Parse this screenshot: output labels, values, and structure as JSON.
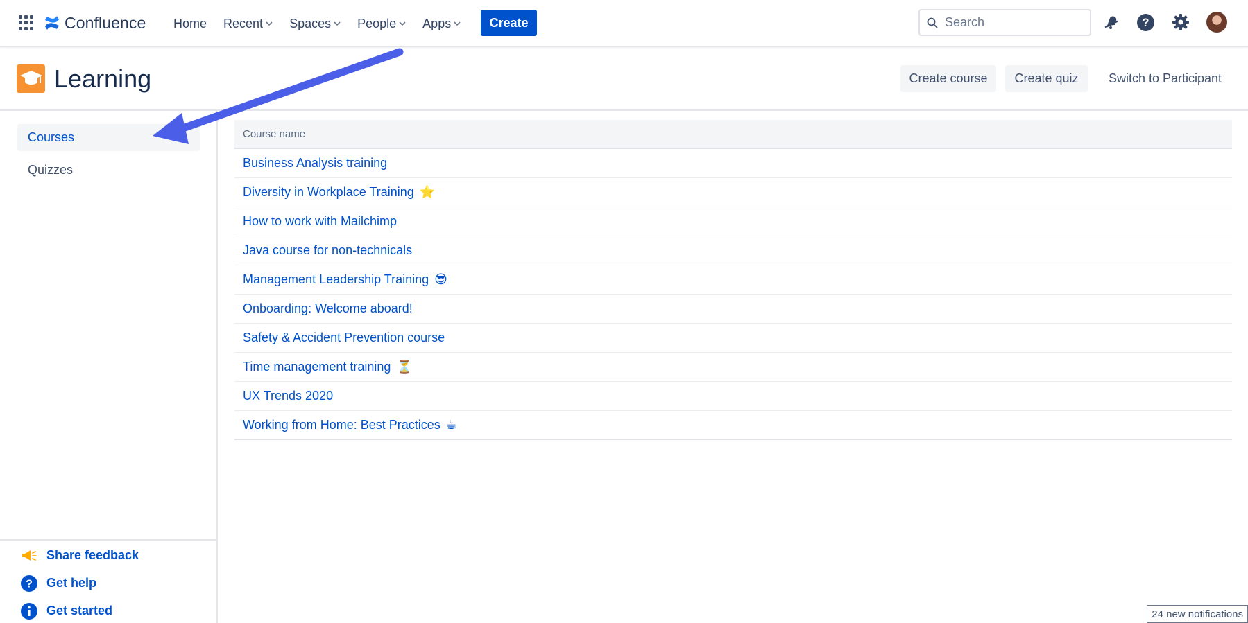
{
  "topnav": {
    "app_name": "Confluence",
    "items": [
      {
        "label": "Home",
        "has_dropdown": false
      },
      {
        "label": "Recent",
        "has_dropdown": true
      },
      {
        "label": "Spaces",
        "has_dropdown": true
      },
      {
        "label": "People",
        "has_dropdown": true
      },
      {
        "label": "Apps",
        "has_dropdown": true
      }
    ],
    "create_label": "Create",
    "search_placeholder": "Search",
    "icons": [
      "notifications-icon",
      "help-icon",
      "settings-icon",
      "avatar"
    ]
  },
  "header": {
    "title": "Learning",
    "buttons": [
      "Create course",
      "Create quiz",
      "Switch to Participant"
    ]
  },
  "sidebar": {
    "items": [
      {
        "label": "Courses",
        "active": true
      },
      {
        "label": "Quizzes",
        "active": false
      }
    ],
    "footer": [
      {
        "label": "Share feedback",
        "icon": "megaphone-icon"
      },
      {
        "label": "Get help",
        "icon": "help-icon"
      },
      {
        "label": "Get started",
        "icon": "info-icon"
      }
    ]
  },
  "table": {
    "column": "Course name",
    "rows": [
      {
        "name": "Business Analysis training",
        "emoji": ""
      },
      {
        "name": "Diversity in Workplace Training",
        "emoji": "⭐"
      },
      {
        "name": "How to work with Mailchimp",
        "emoji": ""
      },
      {
        "name": "Java course for non-technicals",
        "emoji": ""
      },
      {
        "name": "Management Leadership Training",
        "emoji": "😎"
      },
      {
        "name": "Onboarding: Welcome aboard!",
        "emoji": ""
      },
      {
        "name": "Safety & Accident Prevention course",
        "emoji": ""
      },
      {
        "name": "Time management training",
        "emoji": "⏳"
      },
      {
        "name": "UX Trends 2020",
        "emoji": ""
      },
      {
        "name": "Working from Home: Best Practices",
        "emoji": "☕"
      }
    ]
  },
  "notification_toast": "24 new notifications",
  "colors": {
    "brand_blue": "#0052cc",
    "learning_orange": "#f79232",
    "annotation_arrow": "#4a5ee8"
  }
}
